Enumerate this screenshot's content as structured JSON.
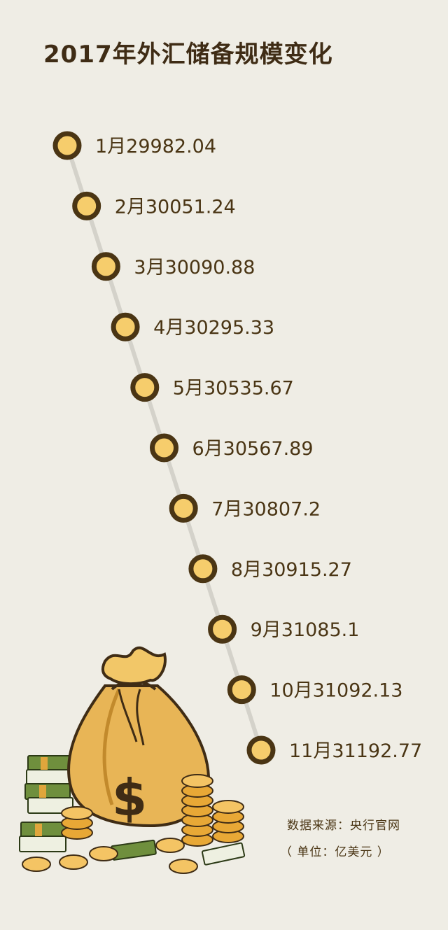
{
  "title": "2017年外汇储备规模变化",
  "source": "数据来源：央行官网",
  "unit": "（ 单位：亿美元 ）",
  "colors": {
    "background": "#efede5",
    "dot_fill": "#f6cd6c",
    "dot_stroke": "#4a3514",
    "text": "#4a3514",
    "title": "#3f2c15",
    "line": "#d4d2ca"
  },
  "illustration": {
    "icon": "money-bag-with-coins-and-banknotes-icon",
    "bag_symbol": "$"
  },
  "chart_data": {
    "type": "line",
    "orientation": "vertical-timeline",
    "title": "2017年外汇储备规模变化",
    "unit": "亿美元",
    "categories": [
      "1月",
      "2月",
      "3月",
      "4月",
      "5月",
      "6月",
      "7月",
      "8月",
      "9月",
      "10月",
      "11月"
    ],
    "values": [
      29982.04,
      30051.24,
      30090.88,
      30295.33,
      30535.67,
      30567.89,
      30807.2,
      30915.27,
      31085.1,
      31092.13,
      31192.77
    ],
    "labels": [
      "29982.04",
      "30051.24",
      "30090.88",
      "30295.33",
      "30535.67",
      "30567.89",
      "30807.2",
      "30915.27",
      "31085.1",
      "31092.13",
      "31192.77"
    ]
  }
}
